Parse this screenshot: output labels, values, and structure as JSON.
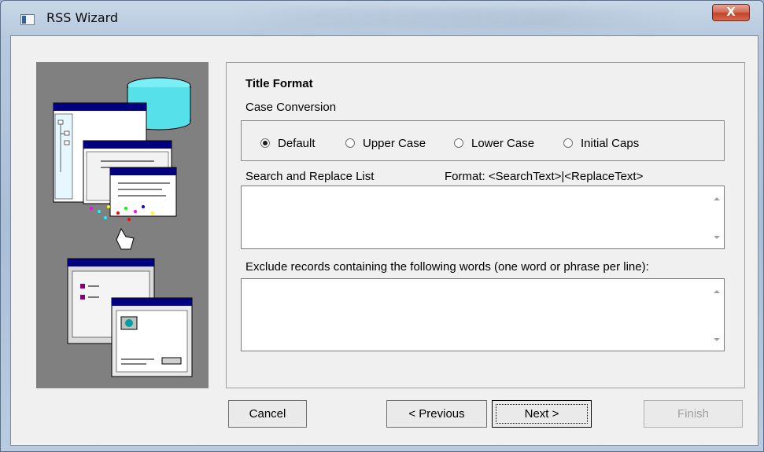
{
  "window": {
    "title": "RSS Wizard",
    "close_symbol": "X",
    "colors": {
      "close_button": "#c94a31",
      "dialog_bg": "#f0f0f0",
      "art_panel_bg": "#808080"
    }
  },
  "section": {
    "heading": "Title Format",
    "case_conversion": {
      "label": "Case Conversion",
      "options": [
        "Default",
        "Upper Case",
        "Lower Case",
        "Initial Caps"
      ],
      "selected": "Default"
    },
    "search_replace": {
      "label": "Search and Replace List",
      "format_hint": "Format:  <SearchText>|<ReplaceText>",
      "value": ""
    },
    "exclude": {
      "label": "Exclude records containing the following words (one word or phrase per line):",
      "value": ""
    }
  },
  "buttons": {
    "cancel": "Cancel",
    "previous": "< Previous",
    "next": "Next >",
    "finish": "Finish"
  },
  "icons": [
    "window-menu-icon",
    "close-icon",
    "wizard-illustration",
    "scroll-up-icon",
    "scroll-down-icon"
  ]
}
